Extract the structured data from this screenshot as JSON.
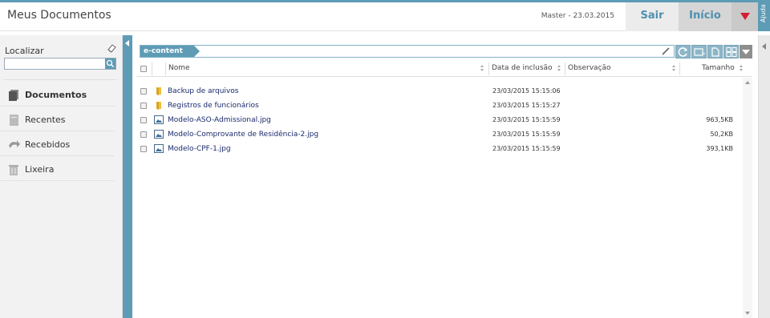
{
  "header": {
    "title": "Meus Documentos",
    "user_info": "Master  -  23.03.2015",
    "logout_label": "Sair",
    "home_label": "Início",
    "help_label": "Ajuda"
  },
  "sidebar": {
    "search_label": "Localizar",
    "search_value": "",
    "items": [
      {
        "label": "Documentos",
        "icon": "documents-icon",
        "active": true
      },
      {
        "label": "Recentes",
        "icon": "recent-icon",
        "active": false
      },
      {
        "label": "Recebidos",
        "icon": "received-icon",
        "active": false
      },
      {
        "label": "Lixeira",
        "icon": "trash-icon",
        "active": false
      }
    ]
  },
  "main": {
    "breadcrumb": "e-content",
    "columns": {
      "name": "Nome",
      "date": "Data de inclusão",
      "note": "Observação",
      "size": "Tamanho"
    },
    "rows": [
      {
        "type": "folder",
        "name": "Backup de arquivos",
        "date": "23/03/2015 15:15:06",
        "size": ""
      },
      {
        "type": "folder",
        "name": "Registros de funcionários",
        "date": "23/03/2015 15:15:27",
        "size": ""
      },
      {
        "type": "image",
        "name": "Modelo-ASO-Admissional.jpg",
        "date": "23/03/2015 15:15:59",
        "size": "963,5KB"
      },
      {
        "type": "image",
        "name": "Modelo-Comprovante de Residência-2.jpg",
        "date": "23/03/2015 15:15:59",
        "size": "50,2KB"
      },
      {
        "type": "image",
        "name": "Modelo-CPF-1.jpg",
        "date": "23/03/2015 15:15:59",
        "size": "393,1KB"
      }
    ]
  },
  "colors": {
    "accent": "#5e9bb5",
    "menu_arrow": "#d41c33",
    "link": "#1a2a6c"
  }
}
